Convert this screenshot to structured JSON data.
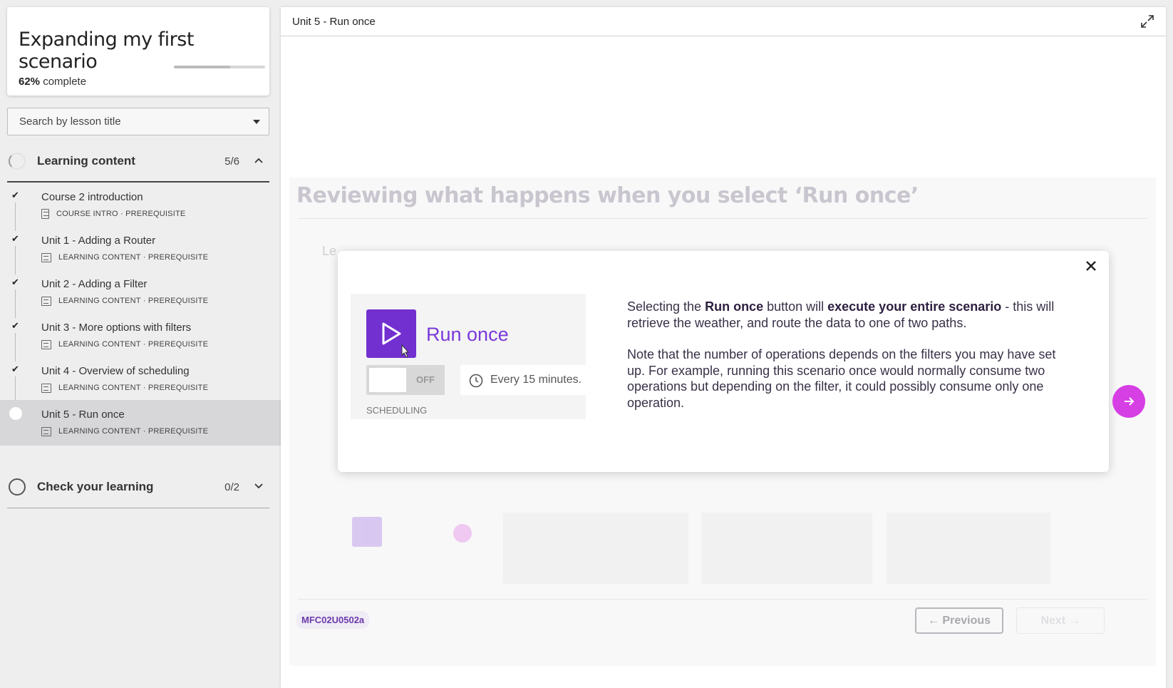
{
  "course": {
    "title": "Expanding my first scenario",
    "percent": "62%",
    "percent_suffix": "complete",
    "progress_fraction": 0.62
  },
  "search": {
    "placeholder": "Search by lesson title"
  },
  "sections": [
    {
      "label": "Learning content",
      "count": "5/6"
    },
    {
      "label": "Check your learning",
      "count": "0/2"
    }
  ],
  "lessons": [
    {
      "title": "Course 2 introduction",
      "meta": "COURSE INTRO · PREREQUISITE"
    },
    {
      "title": "Unit 1 - Adding a Router",
      "meta": "LEARNING CONTENT · PREREQUISITE"
    },
    {
      "title": "Unit 2 - Adding a Filter",
      "meta": "LEARNING CONTENT · PREREQUISITE"
    },
    {
      "title": "Unit 3 - More options with filters",
      "meta": "LEARNING CONTENT · PREREQUISITE"
    },
    {
      "title": "Unit 4 - Overview of scheduling",
      "meta": "LEARNING CONTENT · PREREQUISITE"
    },
    {
      "title": "Unit 5 - Run once",
      "meta": "LEARNING CONTENT · PREREQUISITE"
    }
  ],
  "main": {
    "title": "Unit 5 - Run once",
    "lesson_heading": "Reviewing what happens when you select ‘Run once’",
    "bg_text": "Le",
    "code": "MFC02U0502a",
    "prev_label": "← Previous",
    "next_label": "Next →"
  },
  "modal": {
    "illus_run_label": "Run once",
    "illus_toggle": "OFF",
    "illus_every": "Every 15 minutes.",
    "illus_sched": "SCHEDULING",
    "p1": {
      "a": "Selecting the ",
      "b": "Run once",
      "c": " button will ",
      "d": "execute your entire scenario",
      "e": " - this will retrieve the weather, and route the data to one of two paths."
    },
    "p2": "Note that the number of operations depends on the filters you may have set up. For example, running this scenario once would normally consume two operations but depending on the filter, it could possibly consume only one operation."
  },
  "colors": {
    "accent_purple": "#7230d0",
    "accent_pink": "#d63fe4"
  }
}
